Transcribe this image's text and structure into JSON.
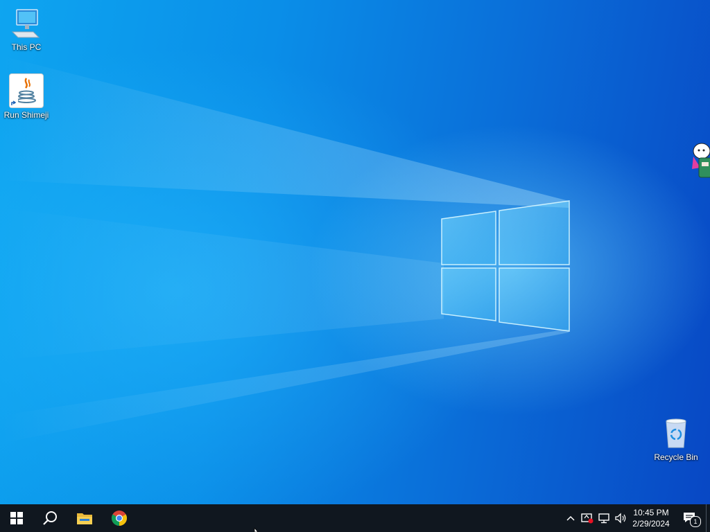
{
  "desktop": {
    "icons": [
      {
        "label": "This PC",
        "icon": "computer-icon"
      },
      {
        "label": "Run Shimeji",
        "icon": "java-icon"
      },
      {
        "label": "Recycle Bin",
        "icon": "recycle-bin-icon"
      }
    ],
    "wallpaper": "windows-10-default",
    "colors": {
      "accent_light": "#0ea5f0",
      "accent_dark": "#0847c4"
    }
  },
  "taskbar": {
    "pinned": [
      {
        "name": "Start",
        "icon": "windows-logo-icon"
      },
      {
        "name": "Search",
        "icon": "search-icon"
      },
      {
        "name": "File Explorer",
        "icon": "folder-icon"
      },
      {
        "name": "Google Chrome",
        "icon": "chrome-icon"
      }
    ],
    "tray": {
      "icons": [
        "chevron-up-icon",
        "security-icon",
        "network-icon",
        "volume-icon"
      ],
      "time": "10:45 PM",
      "date": "2/29/2024",
      "notification_count": "1"
    },
    "background": "#10171f"
  }
}
